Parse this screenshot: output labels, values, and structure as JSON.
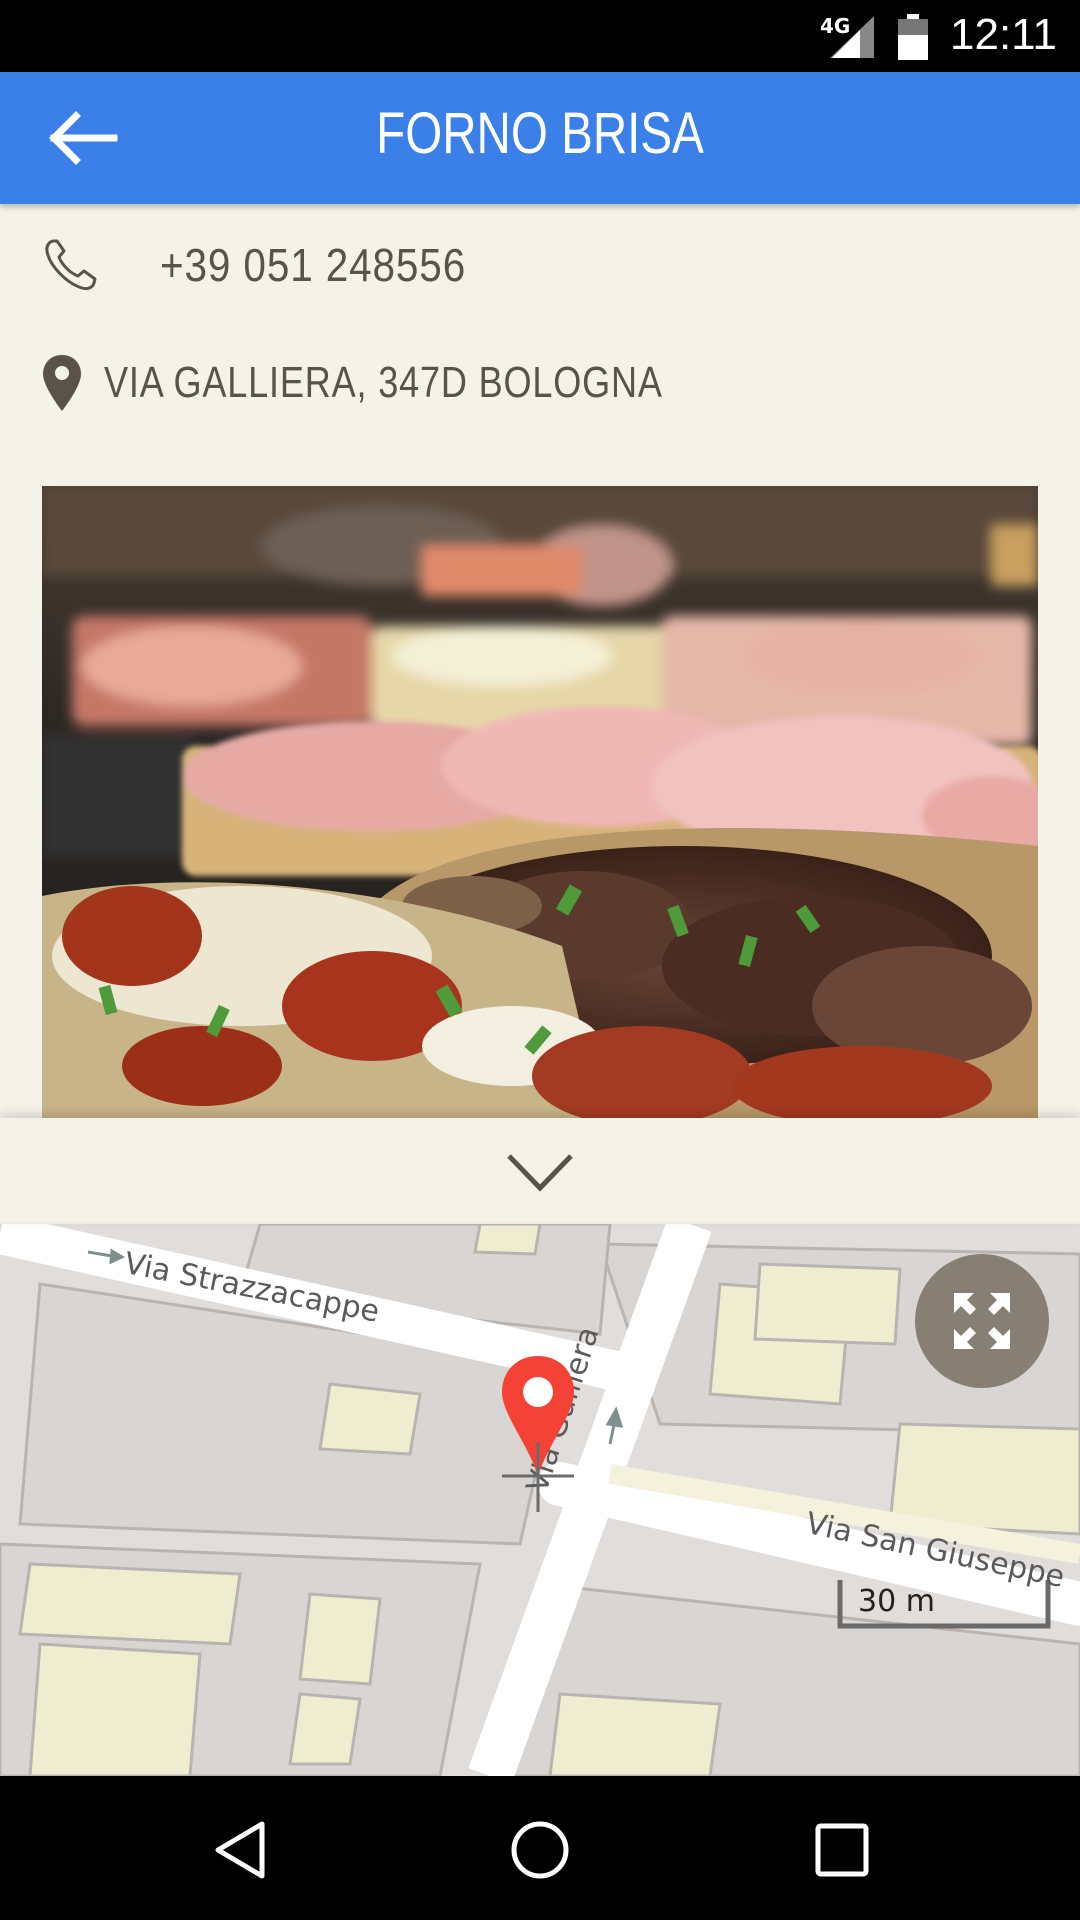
{
  "status_bar": {
    "network": "4G",
    "time": "12:11"
  },
  "app_bar": {
    "title": "FORNO BRISA",
    "back_icon": "arrow-left-icon"
  },
  "contact": {
    "phone": "+39 051 248556",
    "phone_icon": "phone-icon",
    "address": "VIA GALLIERA, 347D BOLOGNA",
    "address_icon": "location-pin-icon"
  },
  "photo": {
    "description_icon": "food-photo"
  },
  "expand": {
    "icon": "chevron-down-icon"
  },
  "map": {
    "streets": [
      "Via Strazzacappe",
      "Via Galliera",
      "Via San Giuseppe"
    ],
    "scale_label": "30 m",
    "fullscreen_icon": "fullscreen-icon",
    "marker_color": "#f44336"
  },
  "nav_bar": {
    "back": "nav-back-icon",
    "home": "nav-home-icon",
    "recents": "nav-recents-icon"
  },
  "colors": {
    "app_bar": "#3b7fe8",
    "background": "#f3f3e9",
    "text": "#5a5347"
  }
}
